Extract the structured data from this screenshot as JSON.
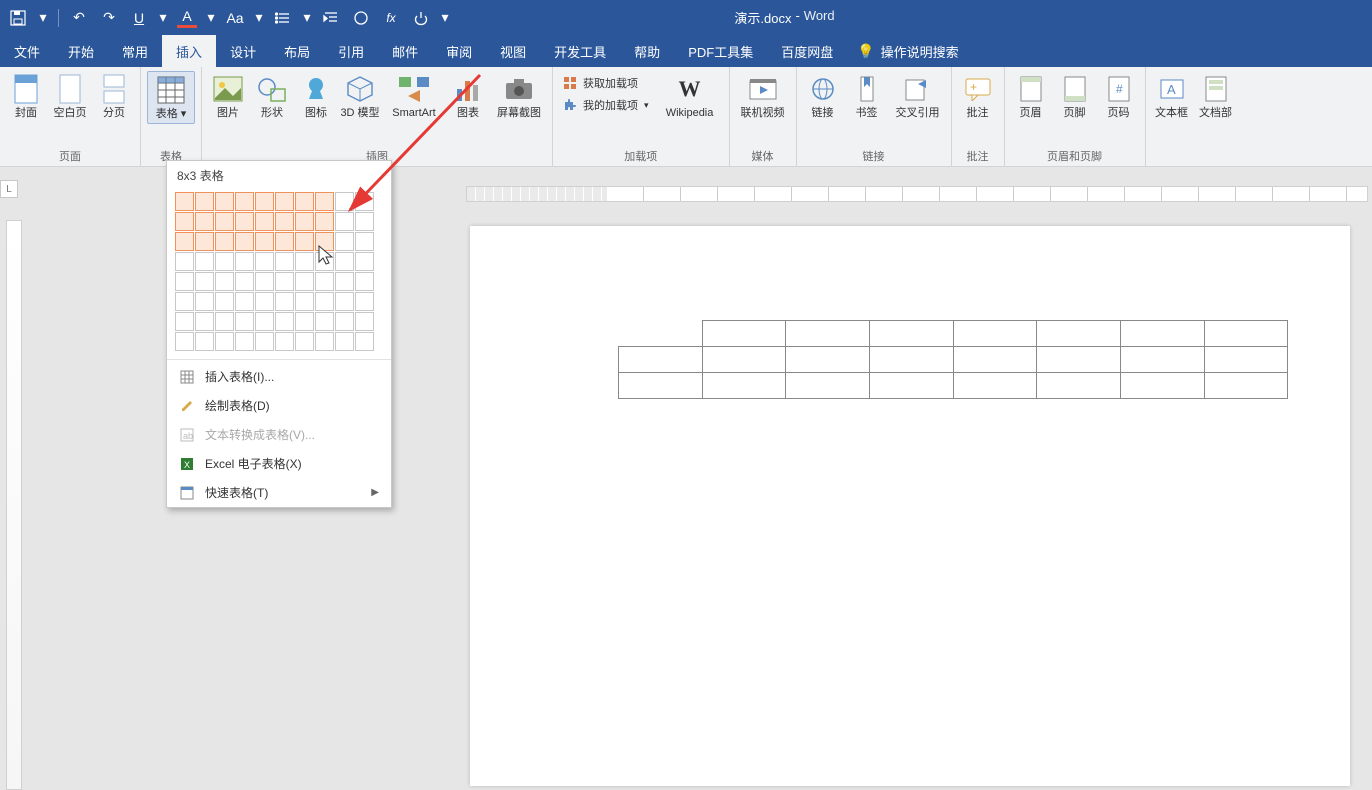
{
  "title": {
    "doc": "演示.docx",
    "app": "Word"
  },
  "qat": {
    "save": "save-icon",
    "undo": "undo-icon",
    "redo": "redo-icon",
    "underline": "U",
    "font_color": "A",
    "case": "Aa",
    "list": "list-icon",
    "indent": "indent-icon",
    "shape": "circle-icon",
    "fx": "fx",
    "touch": "touch-icon"
  },
  "tabs": [
    "文件",
    "开始",
    "常用",
    "插入",
    "设计",
    "布局",
    "引用",
    "邮件",
    "审阅",
    "视图",
    "开发工具",
    "帮助",
    "PDF工具集",
    "百度网盘"
  ],
  "active_tab_index": 3,
  "tell_me": "操作说明搜索",
  "ribbon": {
    "pages": {
      "label": "页面",
      "items": [
        "封面",
        "空白页",
        "分页"
      ]
    },
    "tables": {
      "label": "表格",
      "item": "表格"
    },
    "illustrations": {
      "label": "插图",
      "items": [
        "图片",
        "形状",
        "图标",
        "3D 模型",
        "SmartArt",
        "图表",
        "屏幕截图"
      ]
    },
    "addins": {
      "label": "加载项",
      "get": "获取加载项",
      "my": "我的加载项",
      "wiki": "Wikipedia"
    },
    "media": {
      "label": "媒体",
      "item": "联机视频"
    },
    "links": {
      "label": "链接",
      "items": [
        "链接",
        "书签",
        "交叉引用"
      ]
    },
    "comments": {
      "label": "批注",
      "item": "批注"
    },
    "headerfooter": {
      "label": "页眉和页脚",
      "items": [
        "页眉",
        "页脚",
        "页码"
      ]
    },
    "text": {
      "items": [
        "文本框",
        "文档部"
      ]
    }
  },
  "dropdown": {
    "title_prefix": "8x3",
    "title_suffix": "表格",
    "sel_cols": 8,
    "sel_rows": 3,
    "cols": 10,
    "rows": 8,
    "insert": "插入表格(I)...",
    "draw": "绘制表格(D)",
    "convert": "文本转换成表格(V)...",
    "excel": "Excel 电子表格(X)",
    "quick": "快速表格(T)"
  },
  "doc_table": {
    "rows": 3,
    "cols": 8
  },
  "rulers": {
    "corner": "L"
  }
}
